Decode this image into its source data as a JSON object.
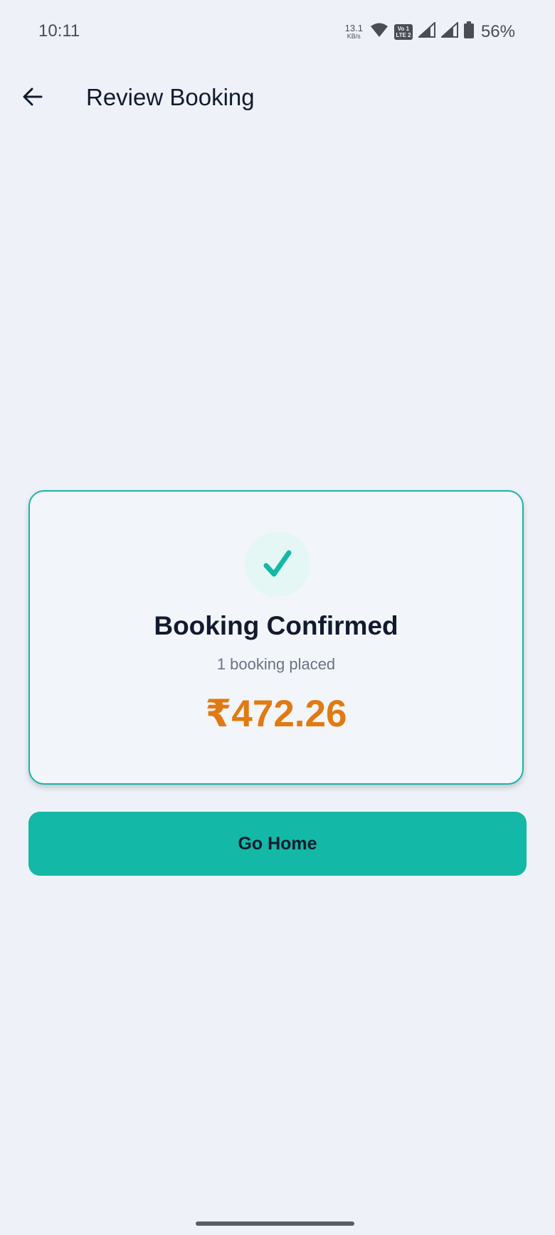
{
  "status_bar": {
    "time": "10:11",
    "net_speed_value": "13.1",
    "net_speed_unit": "KB/s",
    "volte_top": "Vo 1",
    "volte_bottom": "LTE 2",
    "battery_percent": "56%",
    "icons": [
      "wifi-icon",
      "volte-icon",
      "signal-icon",
      "signal-icon",
      "battery-icon"
    ]
  },
  "header": {
    "back_icon": "arrow-left-icon",
    "title": "Review Booking"
  },
  "confirmation": {
    "icon": "check-icon",
    "title": "Booking Confirmed",
    "subtitle": "1 booking placed",
    "amount": "₹472.26"
  },
  "actions": {
    "go_home_label": "Go Home"
  },
  "colors": {
    "background": "#eef2f8",
    "accent": "#14b8a6",
    "amount": "#e07a12",
    "text_primary": "#121a2e",
    "text_secondary": "#6a7384"
  }
}
